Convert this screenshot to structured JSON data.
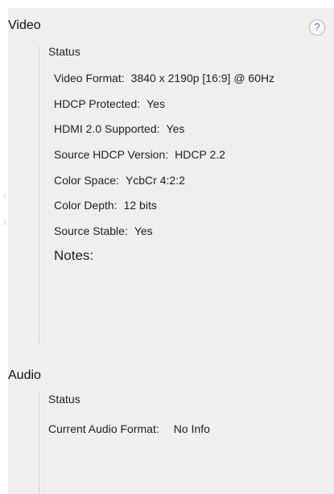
{
  "video": {
    "title": "Video",
    "help_icon": "?",
    "status_label": "Status",
    "rows": [
      {
        "label": "Video Format:",
        "value": "3840 x 2190p [16:9] @ 60Hz"
      },
      {
        "label": "HDCP Protected:",
        "value": "Yes"
      },
      {
        "label": "HDMI 2.0 Supported:",
        "value": "Yes"
      },
      {
        "label": "Source HDCP Version:",
        "value": "HDCP 2.2"
      },
      {
        "label": "Color Space:",
        "value": "YcbCr 4:2:2"
      },
      {
        "label": "Color Depth:",
        "value": "12 bits"
      },
      {
        "label": "Source Stable:",
        "value": "Yes"
      }
    ],
    "notes_label": "Notes:"
  },
  "audio": {
    "title": "Audio",
    "status_label": "Status",
    "rows": [
      {
        "label": "Current Audio Format:",
        "value": "No Info"
      }
    ]
  }
}
